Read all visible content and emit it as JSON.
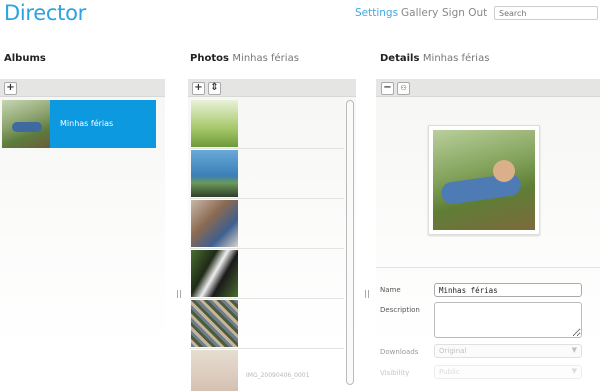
{
  "header": {
    "brand": "Director",
    "nav": [
      "Settings",
      "Gallery",
      "Sign Out"
    ],
    "active_nav": "Settings",
    "search_placeholder": "Search"
  },
  "albums": {
    "title": "Albums",
    "add_label": "+",
    "items": [
      {
        "label": "Minhas férias",
        "selected": true
      }
    ]
  },
  "photos": {
    "title": "Photos",
    "subtitle": "Minhas férias",
    "add_label": "+",
    "sort_label": "⇕",
    "count_visible": 6,
    "filename_partial": "IMG_20090406_0001"
  },
  "details": {
    "title": "Details",
    "subtitle": "Minhas férias",
    "remove_label": "−",
    "people_label": "⚇",
    "fields": {
      "name_label": "Name",
      "name_value": "Minhas férias",
      "description_label": "Description",
      "downloads_label": "Downloads",
      "downloads_value": "Original",
      "visibility_label": "Visibility",
      "visibility_value": "Public"
    }
  },
  "colors": {
    "accent": "#2aa3e0",
    "selected": "#0c99e0"
  }
}
